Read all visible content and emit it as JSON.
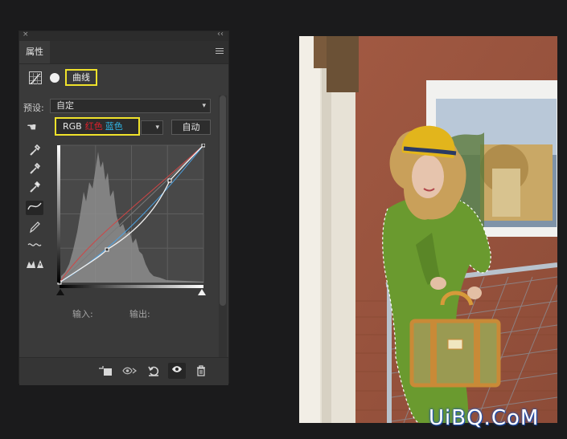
{
  "panel": {
    "close_glyph": "×",
    "collapse_glyph": "‹‹",
    "tab_label": "属性",
    "title": "曲线",
    "preset": {
      "label": "预设:",
      "value": "自定"
    },
    "channels": {
      "rgb": "RGB",
      "red": "红色",
      "blue": "蓝色"
    },
    "auto_label": "自动",
    "io": {
      "input_label": "输入:",
      "output_label": "输出:"
    }
  },
  "colors": {
    "highlight": "#f0e22b",
    "red_text": "#e0202a",
    "blue_text": "#2db7e8"
  },
  "icons": [
    "curves-adjustment-icon",
    "layer-mask-icon",
    "target-adjust-hand-icon",
    "eyedropper-black-icon",
    "eyedropper-gray-icon",
    "eyedropper-white-icon",
    "curve-edit-icon",
    "pencil-icon",
    "smooth-icon",
    "clipping-warning-icon",
    "clip-to-layer-icon",
    "view-previous-icon",
    "reset-icon",
    "visibility-icon",
    "delete-icon"
  ],
  "watermark": "UiBQ.CoM"
}
